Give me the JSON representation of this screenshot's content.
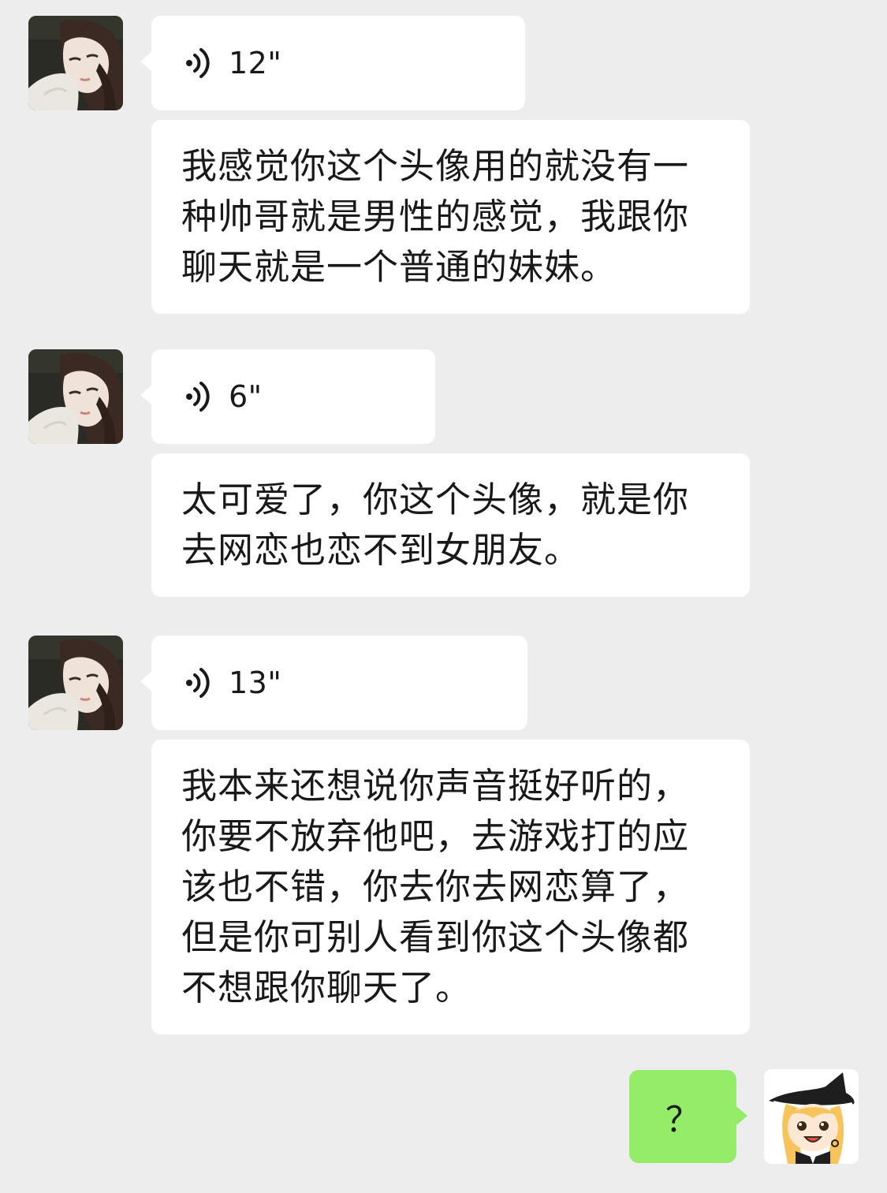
{
  "colors": {
    "background": "#ededed",
    "incoming_bubble": "#ffffff",
    "outgoing_bubble": "#95ec69",
    "text": "#191919"
  },
  "contact": {
    "avatar_icon": "girl-photo-avatar"
  },
  "me": {
    "avatar_icon": "cartoon-witch-avatar"
  },
  "messages": [
    {
      "type": "voice",
      "sender": "contact",
      "duration": "12\"",
      "icon": "voice-wave-icon"
    },
    {
      "type": "text",
      "sender": "contact",
      "text": "我感觉你这个头像用的就没有一种帅哥就是男性的感觉，我跟你聊天就是一个普通的妹妹。"
    },
    {
      "type": "voice",
      "sender": "contact",
      "duration": "6\"",
      "icon": "voice-wave-icon"
    },
    {
      "type": "text",
      "sender": "contact",
      "text": "太可爱了，你这个头像，就是你去网恋也恋不到女朋友。"
    },
    {
      "type": "voice",
      "sender": "contact",
      "duration": "13\"",
      "icon": "voice-wave-icon"
    },
    {
      "type": "text",
      "sender": "contact",
      "text": "我本来还想说你声音挺好听的，你要不放弃他吧，去游戏打的应该也不错，你去你去网恋算了，但是你可别人看到你这个头像都不想跟你聊天了。"
    },
    {
      "type": "text",
      "sender": "me",
      "text": "？"
    }
  ]
}
